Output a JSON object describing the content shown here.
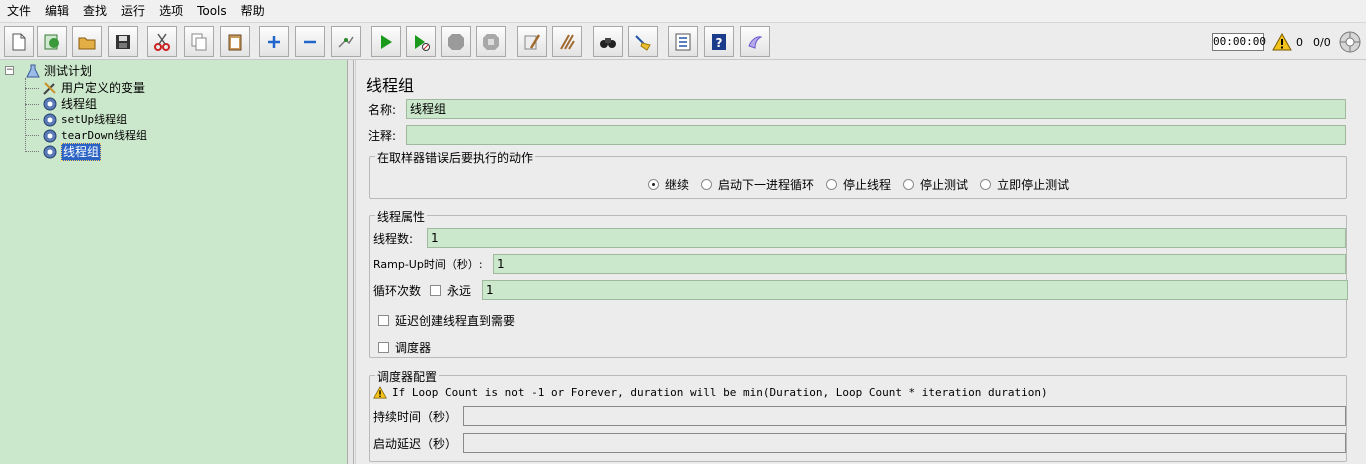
{
  "menu": [
    "文件",
    "编辑",
    "查找",
    "运行",
    "选项",
    "Tools",
    "帮助"
  ],
  "toolbar": {
    "buttons": [
      {
        "name": "new-icon",
        "color": "#ffffff"
      },
      {
        "name": "templates-icon",
        "color": "#3a9a3a"
      },
      {
        "name": "open-icon",
        "color": "#d99a2b"
      },
      {
        "name": "save-icon",
        "color": "#333333"
      },
      {
        "name": "cut-icon",
        "color": "#cc2222"
      },
      {
        "name": "copy-icon",
        "color": "#888888"
      },
      {
        "name": "paste-icon",
        "color": "#b08040"
      },
      {
        "name": "expand-icon",
        "color": "#2266cc"
      },
      {
        "name": "collapse-icon",
        "color": "#2266cc"
      },
      {
        "name": "toggle-icon",
        "color": "#777777"
      },
      {
        "name": "start-icon",
        "color": "#1a9a1a"
      },
      {
        "name": "start-no-pause-icon",
        "color": "#1a9a1a"
      },
      {
        "name": "stop-icon",
        "color": "#9a9a9a"
      },
      {
        "name": "shutdown-icon",
        "color": "#9a9a9a"
      },
      {
        "name": "clear-icon",
        "color": "#a08050"
      },
      {
        "name": "clear-all-icon",
        "color": "#a08050"
      },
      {
        "name": "search-icon",
        "color": "#222222"
      },
      {
        "name": "reset-search-icon",
        "color": "#d8b020"
      },
      {
        "name": "function-helper-icon",
        "color": "#2255aa"
      },
      {
        "name": "help-icon",
        "color": "#1b3c8a"
      },
      {
        "name": "remote-icon",
        "color": "#6a5acd"
      }
    ],
    "timer": "00:00:00",
    "warning_count": "0",
    "threads_ratio": "0/0"
  },
  "tree": {
    "root": "测试计划",
    "items": [
      {
        "label": "用户定义的变量",
        "icon": "wrench-icon"
      },
      {
        "label": "线程组",
        "icon": "gear-icon"
      },
      {
        "label": "setUp线程组",
        "icon": "gear-icon"
      },
      {
        "label": "tearDown线程组",
        "icon": "gear-icon"
      },
      {
        "label": "线程组",
        "icon": "gear-icon",
        "selected": true
      }
    ]
  },
  "form": {
    "title": "线程组",
    "name_label": "名称:",
    "name_value": "线程组",
    "comment_label": "注释:",
    "comment_value": "",
    "on_error": {
      "title": "在取样器错误后要执行的动作",
      "options": [
        "继续",
        "启动下一进程循环",
        "停止线程",
        "停止测试",
        "立即停止测试"
      ],
      "selected": "继续"
    },
    "thread_props": {
      "title": "线程属性",
      "threads_label": "线程数:",
      "threads_value": "1",
      "rampup_label": "Ramp-Up时间（秒）:",
      "rampup_value": "1",
      "loop_label": "循环次数",
      "forever_label": "永远",
      "loop_value": "1",
      "delay_label": "延迟创建线程直到需要",
      "scheduler_label": "调度器"
    },
    "scheduler": {
      "title": "调度器配置",
      "note": "If Loop Count is not -1 or Forever, duration will be min(Duration, Loop Count * iteration duration)",
      "duration_label": "持续时间（秒）",
      "duration_value": "",
      "delay_label": "启动延迟（秒）",
      "delay_value": ""
    }
  },
  "colors": {
    "tree_bg": "#cce8cc",
    "input_bg": "#cce8cc",
    "selection": "#2a63c4"
  }
}
